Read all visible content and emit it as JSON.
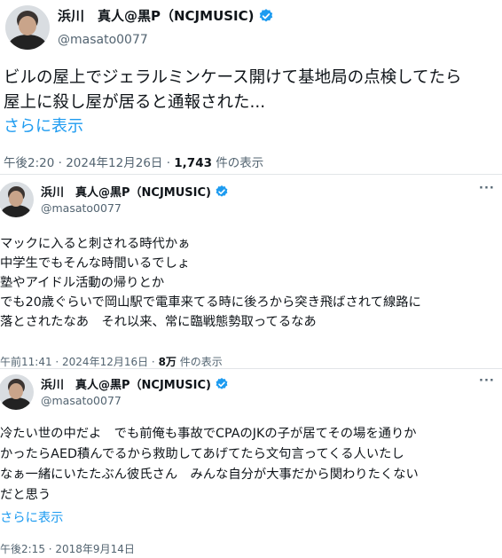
{
  "colors": {
    "link": "#1d9bf0",
    "verified": "#1d9bf0",
    "secondary": "#536471"
  },
  "tweets": [
    {
      "name": "浜川　真人@黒P（NCJMUSIC)",
      "handle": "@masato0077",
      "text_lines": [
        "ビルの屋上でジェラルミンケース開けて基地局の点検してたら",
        "屋上に殺し屋が居ると通報された..."
      ],
      "show_more": "さらに表示",
      "time": "午後2:20 · 2024年12月26日 · ",
      "views": "1,743",
      "views_label": " 件の表示"
    },
    {
      "name": "浜川　真人@黒P（NCJMUSIC)",
      "handle": "@masato0077",
      "more_label": "···",
      "text_lines": [
        "マックに入ると刺される時代かぁ",
        "中学生でもそんな時間いるでしょ",
        "塾やアイドル活動の帰りとか",
        "でも20歳ぐらいで岡山駅で電車来てる時に後ろから突き飛ばされて線路に",
        "落とされたなあ　それ以来、常に臨戦態勢取ってるなあ"
      ],
      "time": "午前11:41 · 2024年12月16日 · ",
      "views": "8万",
      "views_label": " 件の表示"
    },
    {
      "name": "浜川　真人@黒P（NCJMUSIC)",
      "handle": "@masato0077",
      "more_label": "···",
      "text_lines": [
        "冷たい世の中だよ　でも前俺も事故でCPAのJKの子が居てその場を通りか",
        "かったらAED積んでるから救助してあげてたら文句言ってくる人いたし",
        "なぁ一緒にいたたぶん彼氏さん　みんな自分が大事だから関わりたくない",
        "だと思う"
      ],
      "show_more": "さらに表示",
      "time": "午後2:15 · 2018年9月14日"
    }
  ]
}
